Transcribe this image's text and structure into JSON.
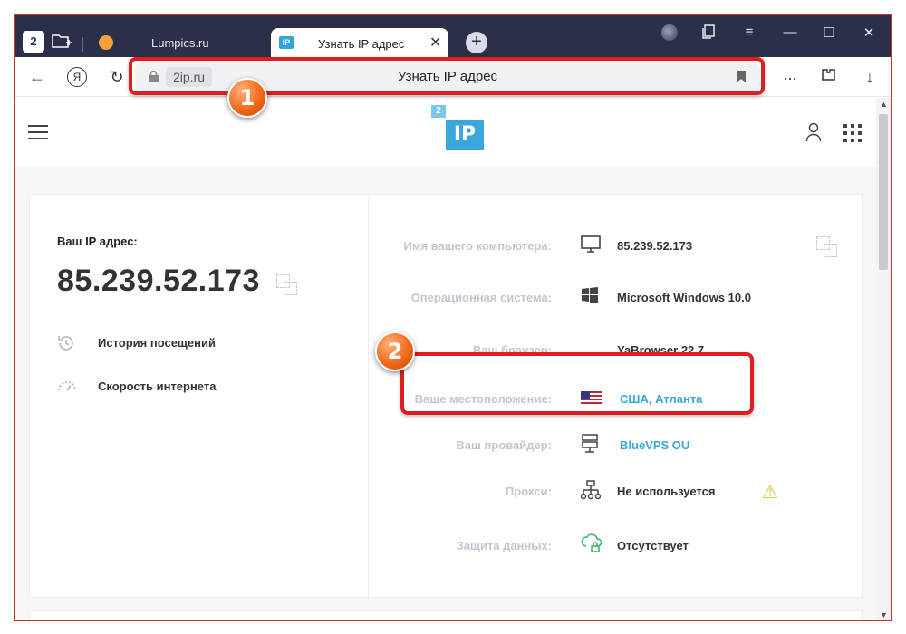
{
  "browser": {
    "home_badge": "2",
    "tabs": [
      {
        "label": "Lumpics.ru"
      },
      {
        "label": "Узнать IP адрес",
        "favicon": "IP"
      }
    ],
    "tab_close": "✕",
    "new_tab": "+",
    "window_controls": {
      "menu": "≡",
      "minimize": "—",
      "maximize": "☐",
      "close": "✕"
    },
    "toolbar": {
      "back": "←",
      "yandex": "Я",
      "reload": "↻",
      "domain": "2ip.ru",
      "title": "Узнать IP адрес",
      "more": "...",
      "download": "↓"
    }
  },
  "annotations": [
    {
      "number": "1",
      "color": "#e11d1d"
    },
    {
      "number": "2",
      "color": "#e11d1d"
    }
  ],
  "site": {
    "logo_small": "2",
    "logo_big": "IP",
    "accent": "#3aa6dc",
    "ip_block": {
      "label": "Ваш IP адрес:",
      "value": "85.239.52.173"
    },
    "links": [
      {
        "label": "История посещений",
        "icon": "history-icon"
      },
      {
        "label": "Скорость интернета",
        "icon": "speedometer-icon"
      }
    ],
    "details": [
      {
        "label": "Имя вашего компьютера:",
        "value": "85.239.52.173",
        "icon": "monitor-icon"
      },
      {
        "label": "Операционная система:",
        "value": "Microsoft Windows 10.0",
        "icon": "windows-icon"
      },
      {
        "label": "Ваш браузер:",
        "value": "YaBrowser 22.7",
        "icon": ""
      },
      {
        "label": "Ваше местоположение:",
        "value": "США, Атланта",
        "icon": "us-flag-icon"
      },
      {
        "label": "Ваш провайдер:",
        "value": "BlueVPS OU",
        "icon": "server-icon"
      },
      {
        "label": "Прокси:",
        "value": "Не используется",
        "icon": "network-icon"
      },
      {
        "label": "Защита данных:",
        "value": "Отсутствует",
        "icon": "cloud-lock-icon"
      }
    ],
    "warning_icon": "⚠"
  }
}
